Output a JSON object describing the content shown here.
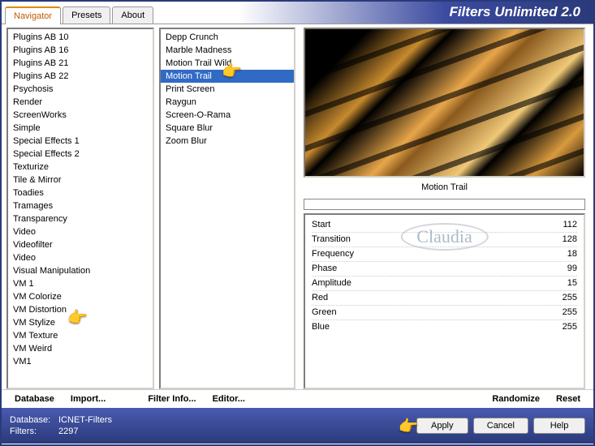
{
  "brand": "Filters Unlimited 2.0",
  "tabs": [
    {
      "label": "Navigator",
      "active": true
    },
    {
      "label": "Presets",
      "active": false
    },
    {
      "label": "About",
      "active": false
    }
  ],
  "categories": [
    "Plugins AB 10",
    "Plugins AB 16",
    "Plugins AB 21",
    "Plugins AB 22",
    "Psychosis",
    "Render",
    "ScreenWorks",
    "Simple",
    "Special Effects 1",
    "Special Effects 2",
    "Texturize",
    "Tile & Mirror",
    "Toadies",
    "Tramages",
    "Transparency",
    "Video",
    "Videofilter",
    "Video",
    "Visual Manipulation",
    "VM 1",
    "VM Colorize",
    "VM Distortion",
    "VM Stylize",
    "VM Texture",
    "VM Weird",
    "VM1"
  ],
  "selected_category_index": 22,
  "filters": [
    "Depp Crunch",
    "Marble Madness",
    "Motion Trail Wild",
    "Motion Trail",
    "Print Screen",
    "Raygun",
    "Screen-O-Rama",
    "Square Blur",
    "Zoom Blur"
  ],
  "selected_filter_index": 3,
  "preview_label": "Motion Trail",
  "params": [
    {
      "name": "Start",
      "value": 112
    },
    {
      "name": "Transition",
      "value": 128
    },
    {
      "name": "Frequency",
      "value": 18
    },
    {
      "name": "Phase",
      "value": 99
    },
    {
      "name": "Amplitude",
      "value": 15
    },
    {
      "name": "Red",
      "value": 255
    },
    {
      "name": "Green",
      "value": 255
    },
    {
      "name": "Blue",
      "value": 255
    }
  ],
  "watermark": "Claudia",
  "toolbar": {
    "database": "Database",
    "import": "Import...",
    "filter_info": "Filter Info...",
    "editor": "Editor...",
    "randomize": "Randomize",
    "reset": "Reset"
  },
  "status": {
    "database_label": "Database:",
    "database_value": "ICNET-Filters",
    "filters_label": "Filters:",
    "filters_value": "2297"
  },
  "buttons": {
    "apply": "Apply",
    "cancel": "Cancel",
    "help": "Help"
  }
}
